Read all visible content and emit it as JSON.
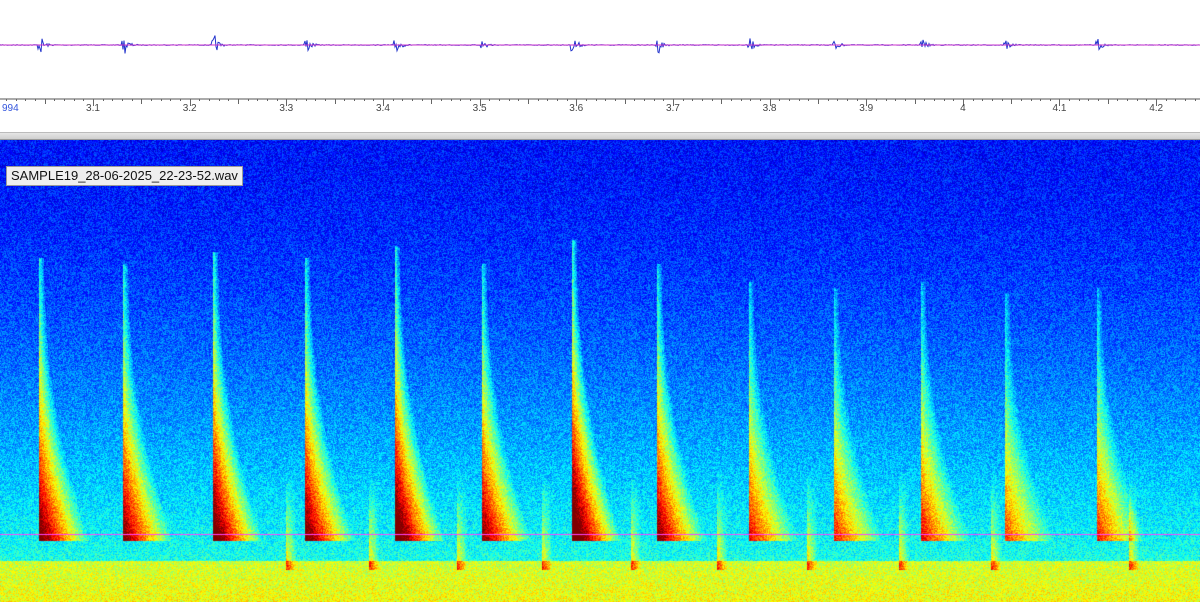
{
  "file": {
    "name": "SAMPLE19_28-06-2025_22-23-52.wav"
  },
  "timeline": {
    "first_label": "994",
    "ticks": [
      "3.1",
      "3.2",
      "3.3",
      "3.4",
      "3.5",
      "3.6",
      "3.7",
      "3.8",
      "3.9",
      "4",
      "4.1",
      "4.2"
    ]
  },
  "colors": {
    "waveform": "#2233cc",
    "baseline": "#cc33cc",
    "frequency_marker": "#ff44ff",
    "spectrogram_low": "#001a8f",
    "spectrogram_high": "#d40000"
  },
  "pulses": [
    {
      "time": 3.046,
      "strength": 0.85
    },
    {
      "time": 3.133,
      "strength": 0.8
    },
    {
      "time": 3.226,
      "strength": 0.9
    },
    {
      "time": 3.321,
      "strength": 0.85
    },
    {
      "time": 3.414,
      "strength": 0.95
    },
    {
      "time": 3.504,
      "strength": 0.8
    },
    {
      "time": 3.597,
      "strength": 1.0
    },
    {
      "time": 3.685,
      "strength": 0.8
    },
    {
      "time": 3.78,
      "strength": 0.65
    },
    {
      "time": 3.868,
      "strength": 0.6
    },
    {
      "time": 3.958,
      "strength": 0.65
    },
    {
      "time": 4.045,
      "strength": 0.55
    },
    {
      "time": 4.14,
      "strength": 0.6
    }
  ]
}
